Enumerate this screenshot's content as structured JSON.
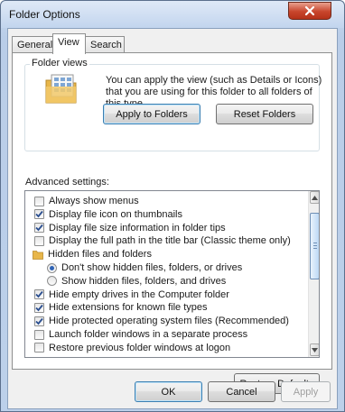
{
  "window": {
    "title": "Folder Options"
  },
  "tabs": [
    {
      "label": "General",
      "active": false
    },
    {
      "label": "View",
      "active": true
    },
    {
      "label": "Search",
      "active": false
    }
  ],
  "folder_views": {
    "title": "Folder views",
    "description": "You can apply the view (such as Details or Icons) that you are using for this folder to all folders of this type.",
    "apply_label": "Apply to Folders",
    "reset_label": "Reset Folders"
  },
  "advanced": {
    "label": "Advanced settings:",
    "items": [
      {
        "kind": "checkbox",
        "label": "Always show menus",
        "checked": false
      },
      {
        "kind": "checkbox",
        "label": "Display file icon on thumbnails",
        "checked": true
      },
      {
        "kind": "checkbox",
        "label": "Display file size information in folder tips",
        "checked": true
      },
      {
        "kind": "checkbox",
        "label": "Display the full path in the title bar (Classic theme only)",
        "checked": false
      },
      {
        "kind": "folder",
        "label": "Hidden files and folders"
      },
      {
        "kind": "radio",
        "label": "Don't show hidden files, folders, or drives",
        "checked": true
      },
      {
        "kind": "radio",
        "label": "Show hidden files, folders, and drives",
        "checked": false
      },
      {
        "kind": "checkbox",
        "label": "Hide empty drives in the Computer folder",
        "checked": true
      },
      {
        "kind": "checkbox",
        "label": "Hide extensions for known file types",
        "checked": true
      },
      {
        "kind": "checkbox",
        "label": "Hide protected operating system files (Recommended)",
        "checked": true
      },
      {
        "kind": "checkbox",
        "label": "Launch folder windows in a separate process",
        "checked": false
      },
      {
        "kind": "checkbox",
        "label": "Restore previous folder windows at logon",
        "checked": false
      }
    ]
  },
  "restore_defaults_label": "Restore Defaults",
  "dialog_buttons": {
    "ok": "OK",
    "cancel": "Cancel",
    "apply": "Apply"
  },
  "colors": {
    "accent": "#2f63b5",
    "close": "#c8452c",
    "folder": "#e8b64a"
  }
}
